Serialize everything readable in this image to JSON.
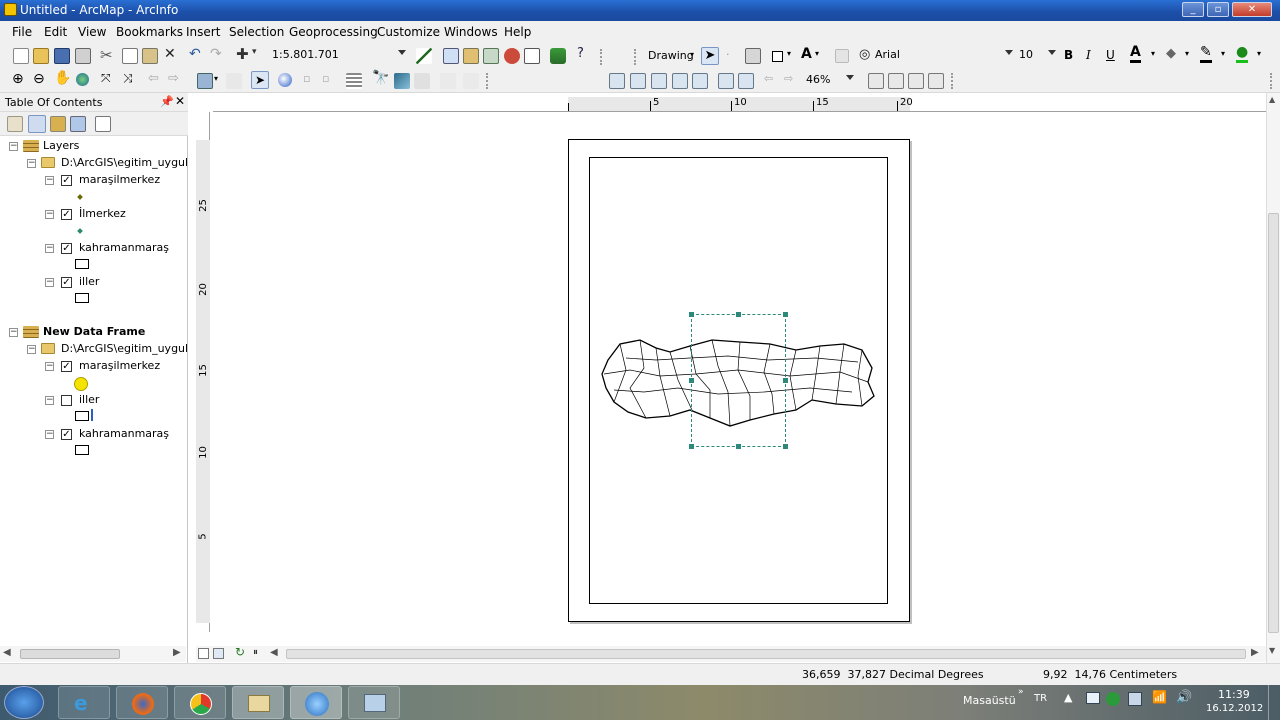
{
  "window": {
    "title": "Untitled - ArcMap - ArcInfo"
  },
  "menu": [
    "File",
    "Edit",
    "View",
    "Bookmarks",
    "Insert",
    "Selection",
    "Geoprocessing",
    "Customize",
    "Windows",
    "Help"
  ],
  "toolbar": {
    "scale": "1:5.801.701",
    "drawing_label": "Drawing",
    "font_name": "Arial",
    "font_size": "10",
    "bold": "B",
    "italic": "I",
    "underline": "U",
    "text_tool": "A",
    "zoom_percent": "46%"
  },
  "toc": {
    "title": "Table Of Contents",
    "frames": [
      {
        "name": "Layers",
        "path": "D:\\ArcGIS\\egitim_uygulam",
        "layers": [
          {
            "name": "maraşilmerkez",
            "checked": true,
            "symbol": "point"
          },
          {
            "name": "İlmerkez",
            "checked": true,
            "symbol": "point"
          },
          {
            "name": "kahramanmaraş",
            "checked": true,
            "symbol": "polygon"
          },
          {
            "name": "iller",
            "checked": true,
            "symbol": "polygon"
          }
        ]
      },
      {
        "name": "New Data Frame",
        "path": "D:\\ArcGIS\\egitim_uygulam",
        "layers": [
          {
            "name": "maraşilmerkez",
            "checked": true,
            "symbol": "yellow-circle"
          },
          {
            "name": "iller",
            "checked": false,
            "symbol": "polygon"
          },
          {
            "name": "kahramanmaraş",
            "checked": true,
            "symbol": "polygon"
          }
        ]
      }
    ]
  },
  "ruler": {
    "top": [
      "5",
      "10",
      "15",
      "20"
    ],
    "left": [
      "25",
      "20",
      "15",
      "10",
      "5"
    ]
  },
  "status": {
    "coords": "36,659  37,827 Decimal Degrees",
    "page_coords": "9,92  14,76 Centimeters"
  },
  "taskbar": {
    "desktop_label": "Masaüstü",
    "lang": "TR",
    "time": "11:39",
    "date": "16.12.2012"
  },
  "colors": {
    "title_bar": "#1c4fa8",
    "selection_handle": "#2d8a7a",
    "symbol_yellow": "#f5e400"
  }
}
